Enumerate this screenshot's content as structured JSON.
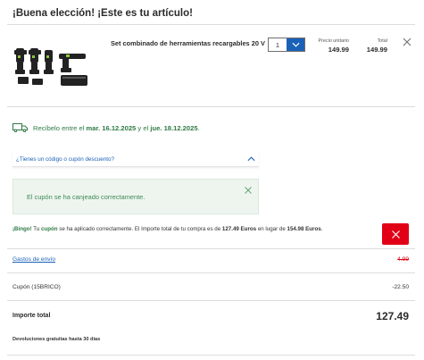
{
  "header": {
    "title": "¡Buena elección! ¡Este es tu artículo!"
  },
  "product": {
    "name": "Set combinado de herramientas recargables 20 V",
    "quantity": "1",
    "unit_price_label": "Precio unitario",
    "unit_price": "149.99",
    "total_label": "Total",
    "total": "149.99"
  },
  "delivery": {
    "prefix": "Recíbelo entre el",
    "from": "mar. 16.12.2025",
    "middle": "y el",
    "to": "jue. 18.12.2025",
    "suffix": "."
  },
  "coupon": {
    "toggle_label": "¿Tienes un código o cupón descuento?",
    "success_message": "El cupón se ha canjeado correctamente."
  },
  "bingo": {
    "lead": "¡Bingo!",
    "t1": " Tu ",
    "cupon": "cupón",
    "t2": " se ha aplicado correctamente. El Importe total de tu compra es de ",
    "new_total": "127.49 Euros",
    "t3": " en lugar de ",
    "old_total": "154.98 Euros",
    "t4": "."
  },
  "summary": {
    "shipping_label": "Gastos de envío",
    "shipping_value": "4.99",
    "coupon_label": "Cupón (15BRICO)",
    "coupon_value": "-22.50",
    "total_label": "Importe total",
    "total_value": "127.49",
    "returns_note": "Devoluciones gratuitas hasta 30 días"
  },
  "colors": {
    "accent_blue": "#1a61b8",
    "success_green": "#2e7a44",
    "alert_red": "#e10015"
  }
}
